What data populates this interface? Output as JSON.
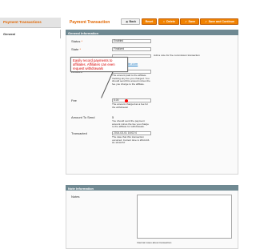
{
  "sidebar": {
    "title": "Payment Transactions",
    "tab": "General"
  },
  "header": {
    "title": "Payment Transaction"
  },
  "buttons": [
    {
      "label": "Back",
      "icon": "back-icon",
      "style": "light"
    },
    {
      "label": "Reset",
      "icon": "reset-icon",
      "style": "orange"
    },
    {
      "label": "Delete",
      "icon": "delete-icon",
      "style": "orange"
    },
    {
      "label": "Save",
      "icon": "save-icon",
      "style": "orange"
    },
    {
      "label": "Save and Continue",
      "icon": "save-continue-icon",
      "style": "orange"
    }
  ],
  "sections": {
    "general": "General Information",
    "notes": "Note Information"
  },
  "fields": {
    "status_label": "Status",
    "status_value": "Enabled",
    "state_label": "State",
    "state_value": "Finalized",
    "transaction_note": "Add a note for the commission transaction",
    "affiliate_label": "Affiliate",
    "affiliate_value": "aff@example.com",
    "amount_label": "Amount",
    "amount_value": "10.00",
    "amount_note": "The amount paid to the affiliate tracking any fee you charged. You should send this amount minus the fee you charge to the affiliate.",
    "fee_label": "Fee",
    "fee_value": "5.00",
    "fee_note": "The amount charged as a fee for the withdrawal",
    "amount_send_label": "Amount To Send",
    "amount_send_value": "5",
    "amount_send_note": "You should send the payment amount minus the fee you charge to the affiliate for withdrawals.",
    "transacted_label": "Transacted",
    "transacted_value": "2014-03-01 16:02:4",
    "transacted_note": "The date that this transaction occurred. Current time is 2014-03-01 16:02:57",
    "notes_label": "Notes",
    "notes_footer": "Internal notes about transaction"
  },
  "tooltip": "Easily record payments to affiliates. Affiliates can even request withdrawals",
  "colors": {
    "accent": "#e26703",
    "button": "#f18200",
    "section": "#6f8992",
    "tooltip_text": "#d70000"
  }
}
